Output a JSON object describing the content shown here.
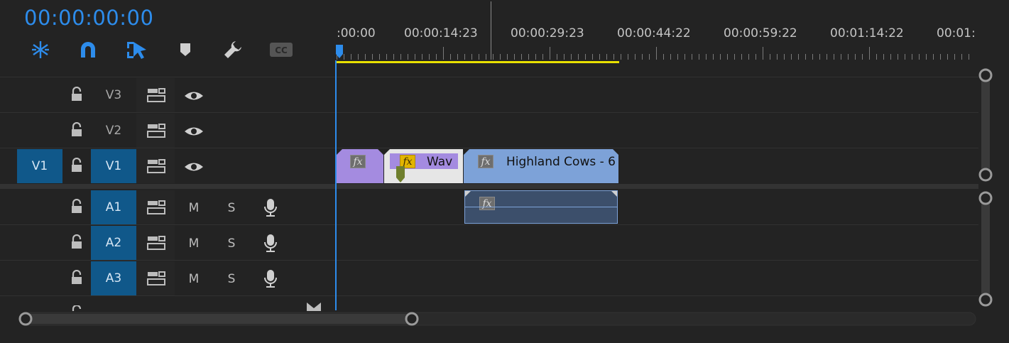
{
  "timecode": "00:00:00:00",
  "ruler": {
    "labels": [
      ":00:00",
      "00:00:14:23",
      "00:00:29:23",
      "00:00:44:22",
      "00:00:59:22",
      "00:01:14:22",
      "00:01:"
    ]
  },
  "tools": [
    "ripple-sequence-icon",
    "snap-magnet-icon",
    "linked-selection-icon",
    "add-marker-icon",
    "wrench-settings-icon",
    "closed-caption-icon"
  ],
  "tools_cc_label": "CC",
  "video_tracks": [
    {
      "name": "V3"
    },
    {
      "name": "V2"
    },
    {
      "name": "V1",
      "source": "V1"
    }
  ],
  "audio_tracks": [
    {
      "name": "A1",
      "mute": "M",
      "solo": "S"
    },
    {
      "name": "A2",
      "mute": "M",
      "solo": "S"
    },
    {
      "name": "A3",
      "mute": "M",
      "solo": "S"
    }
  ],
  "clips": {
    "clip2_label": "Wav",
    "clip3_label": "Highland Cows - 6",
    "fx_label": "fx"
  },
  "colors": {
    "accent": "#2d8ceb",
    "track_selected": "#10588a",
    "work_area": "#e8e000",
    "clip_purple": "#a48be0",
    "clip_blue": "#7da2d8",
    "audio_clip": "#3c4f6b"
  }
}
